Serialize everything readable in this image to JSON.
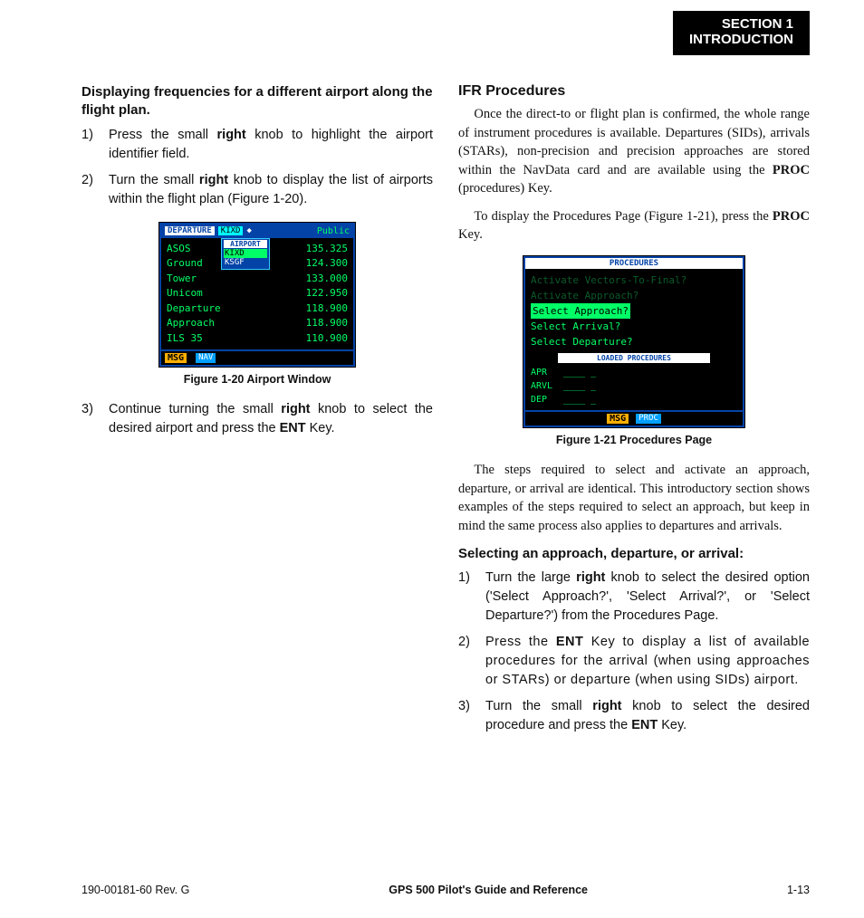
{
  "section_tab": {
    "line1": "SECTION 1",
    "line2": "INTRODUCTION"
  },
  "left": {
    "heading": "Displaying frequencies for a different airport along the flight plan.",
    "steps_a": [
      {
        "n": "1)",
        "pre": "Press the small ",
        "b1": "right",
        "post": " knob to highlight the airport identifier field."
      },
      {
        "n": "2)",
        "pre": "Turn the small ",
        "b1": "right",
        "post": " knob to display the list of airports within the flight plan (Figure 1-20)."
      }
    ],
    "fig": {
      "caption": "Figure 1-20  Airport Window",
      "topbar": {
        "departure": "DEPARTURE",
        "code": "KIXD",
        "pub": "Public"
      },
      "popup": {
        "hdr": "AIRPORT",
        "opts": [
          "KIXD",
          "KSGF"
        ]
      },
      "rows": [
        {
          "name": "ASOS",
          "val": "135.325"
        },
        {
          "name": "Ground",
          "val": "124.300"
        },
        {
          "name": "Tower",
          "val": "133.000"
        },
        {
          "name": "Unicom",
          "val": "122.950"
        },
        {
          "name": "Departure",
          "val": "118.900"
        },
        {
          "name": "Approach",
          "val": "118.900"
        },
        {
          "name": "ILS 35",
          "val": "110.900"
        }
      ],
      "bot": {
        "msg": "MSG",
        "nav": "NAV"
      }
    },
    "steps_b": [
      {
        "n": "3)",
        "pre": "Continue turning the small ",
        "b1": "right",
        "mid": " knob to select the desired airport and press the ",
        "b2": "ENT",
        "post": " Key."
      }
    ]
  },
  "right": {
    "topic": "IFR Procedures",
    "p1_pre": "Once the direct-to or flight plan is confirmed, the whole range of instrument procedures is available.  Departures (SIDs), arrivals (STARs), non-precision and precision approaches are stored within the NavData card and are available using the ",
    "p1_b": "PROC",
    "p1_post": " (procedures) Key.",
    "p2_pre": "To display the Procedures Page (Figure 1-21), press the ",
    "p2_b": "PROC",
    "p2_post": " Key.",
    "fig": {
      "caption": "Figure 1-21  Procedures Page",
      "title": "PROCEDURES",
      "rows": [
        {
          "t": "Activate Vectors-To-Final?",
          "dim": true
        },
        {
          "t": "Activate Approach?",
          "dim": true
        },
        {
          "t": "Select Approach?",
          "sel": true
        },
        {
          "t": "Select Arrival?"
        },
        {
          "t": "Select Departure?"
        }
      ],
      "subtitle": "LOADED PROCEDURES",
      "loaded": [
        {
          "lbl": "APR",
          "dash": "____ _"
        },
        {
          "lbl": "ARVL",
          "dash": "____ _"
        },
        {
          "lbl": "DEP",
          "dash": "____ _"
        }
      ],
      "bot": {
        "msg": "MSG",
        "pg": "PROC"
      }
    },
    "p3": "The steps required to select and activate an approach, departure, or arrival are identical.  This introductory section shows examples of the steps required to select an approach, but keep in mind the same process also applies to departures and arrivals.",
    "heading2": "Selecting an approach, departure, or arrival:",
    "steps": [
      {
        "n": "1)",
        "pre": "Turn the large ",
        "b1": "right",
        "post": " knob to select the desired option ('Select Approach?', 'Select Arrival?', or 'Select Departure?') from the Procedures Page."
      },
      {
        "n": "2)",
        "pre": "Press the ",
        "b1": "ENT",
        "post": " Key to display a list of available procedures for the arrival (when using approaches or STARs) or departure (when using SIDs) airport."
      },
      {
        "n": "3)",
        "pre": "Turn the small ",
        "b1": "right",
        "mid": " knob to select the desired procedure and press the ",
        "b2": "ENT",
        "post": " Key."
      }
    ]
  },
  "footer": {
    "left": "190-00181-60  Rev. G",
    "mid": "GPS 500 Pilot's Guide and Reference",
    "right": "1-13"
  }
}
